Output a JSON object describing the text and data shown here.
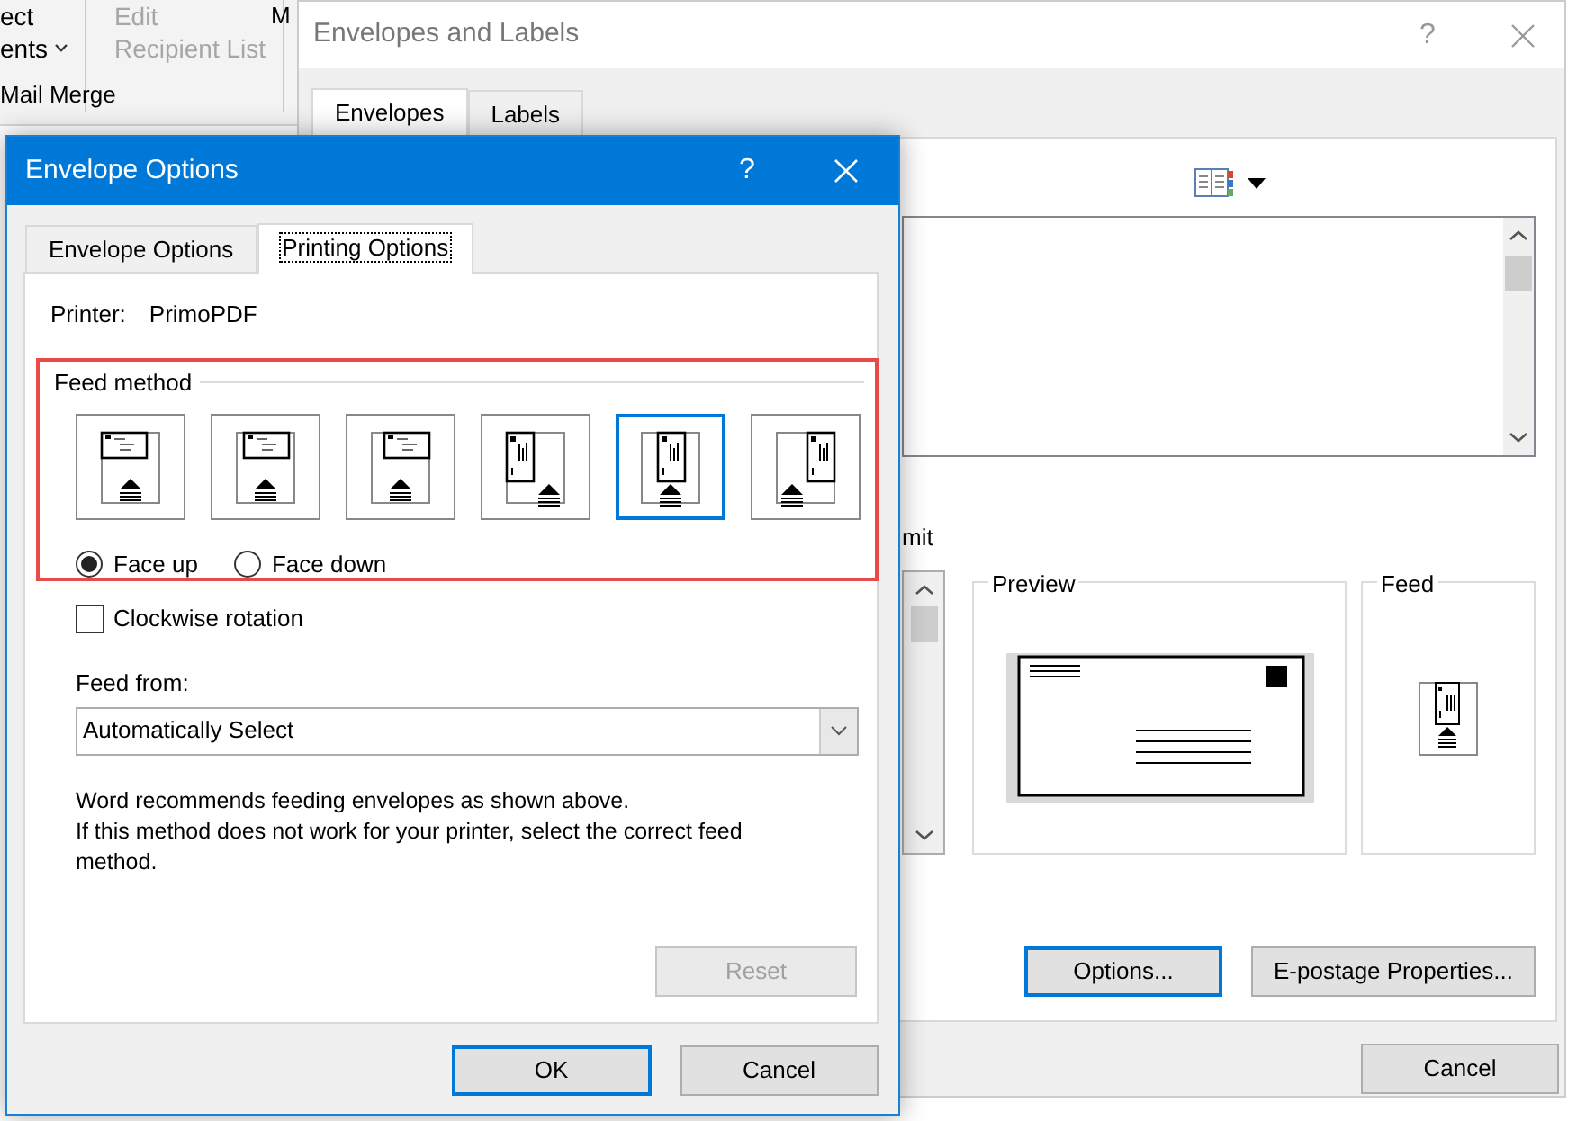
{
  "ribbon": {
    "buttons": [
      {
        "lines": [
          "ect",
          "ents"
        ],
        "dropdown": true,
        "disabled": false
      },
      {
        "lines": [
          "Edit",
          "Recipient List"
        ],
        "dropdown": false,
        "disabled": true
      },
      {
        "lines": [
          "M"
        ],
        "dropdown": false,
        "disabled": false
      }
    ],
    "group_label": "Mail Merge"
  },
  "envelopes_dialog": {
    "title": "Envelopes and Labels",
    "help": "?",
    "tabs": [
      {
        "label": "Envelopes",
        "selected": true
      },
      {
        "label": "Labels",
        "selected": false
      }
    ],
    "omit_label": "mit",
    "preview_label": "Preview",
    "feed_label": "Feed",
    "buttons": [
      {
        "label": "Options...",
        "focused": true
      },
      {
        "label": "E-postage Properties...",
        "focused": false
      }
    ],
    "cancel": "Cancel"
  },
  "envelope_options_dialog": {
    "title": "Envelope Options",
    "help": "?",
    "tabs": [
      {
        "label": "Envelope Options",
        "selected": false
      },
      {
        "label": "Printing Options",
        "selected": true
      }
    ],
    "printer_label": "Printer:",
    "printer": "PrimoPDF",
    "feed_method": {
      "label": "Feed method",
      "highlighted": true,
      "options": [
        {
          "kind": "landscape-left",
          "selected": false
        },
        {
          "kind": "landscape-center",
          "selected": false
        },
        {
          "kind": "landscape-right",
          "selected": false
        },
        {
          "kind": "portrait-left",
          "selected": false
        },
        {
          "kind": "portrait-center",
          "selected": true
        },
        {
          "kind": "portrait-right",
          "selected": false
        }
      ]
    },
    "face": [
      {
        "label": "Face up",
        "selected": true
      },
      {
        "label": "Face down",
        "selected": false
      }
    ],
    "clockwise_rotation": {
      "label": "Clockwise rotation",
      "checked": false
    },
    "feed_from": {
      "label": "Feed from:",
      "value": "Automatically Select"
    },
    "note": [
      "Word recommends feeding envelopes as shown above.",
      "If this method does not work for your printer, select the correct feed method."
    ],
    "reset": {
      "label": "Reset",
      "disabled": true
    },
    "buttons": [
      {
        "label": "OK",
        "focused": true
      },
      {
        "label": "Cancel",
        "focused": false
      }
    ]
  }
}
